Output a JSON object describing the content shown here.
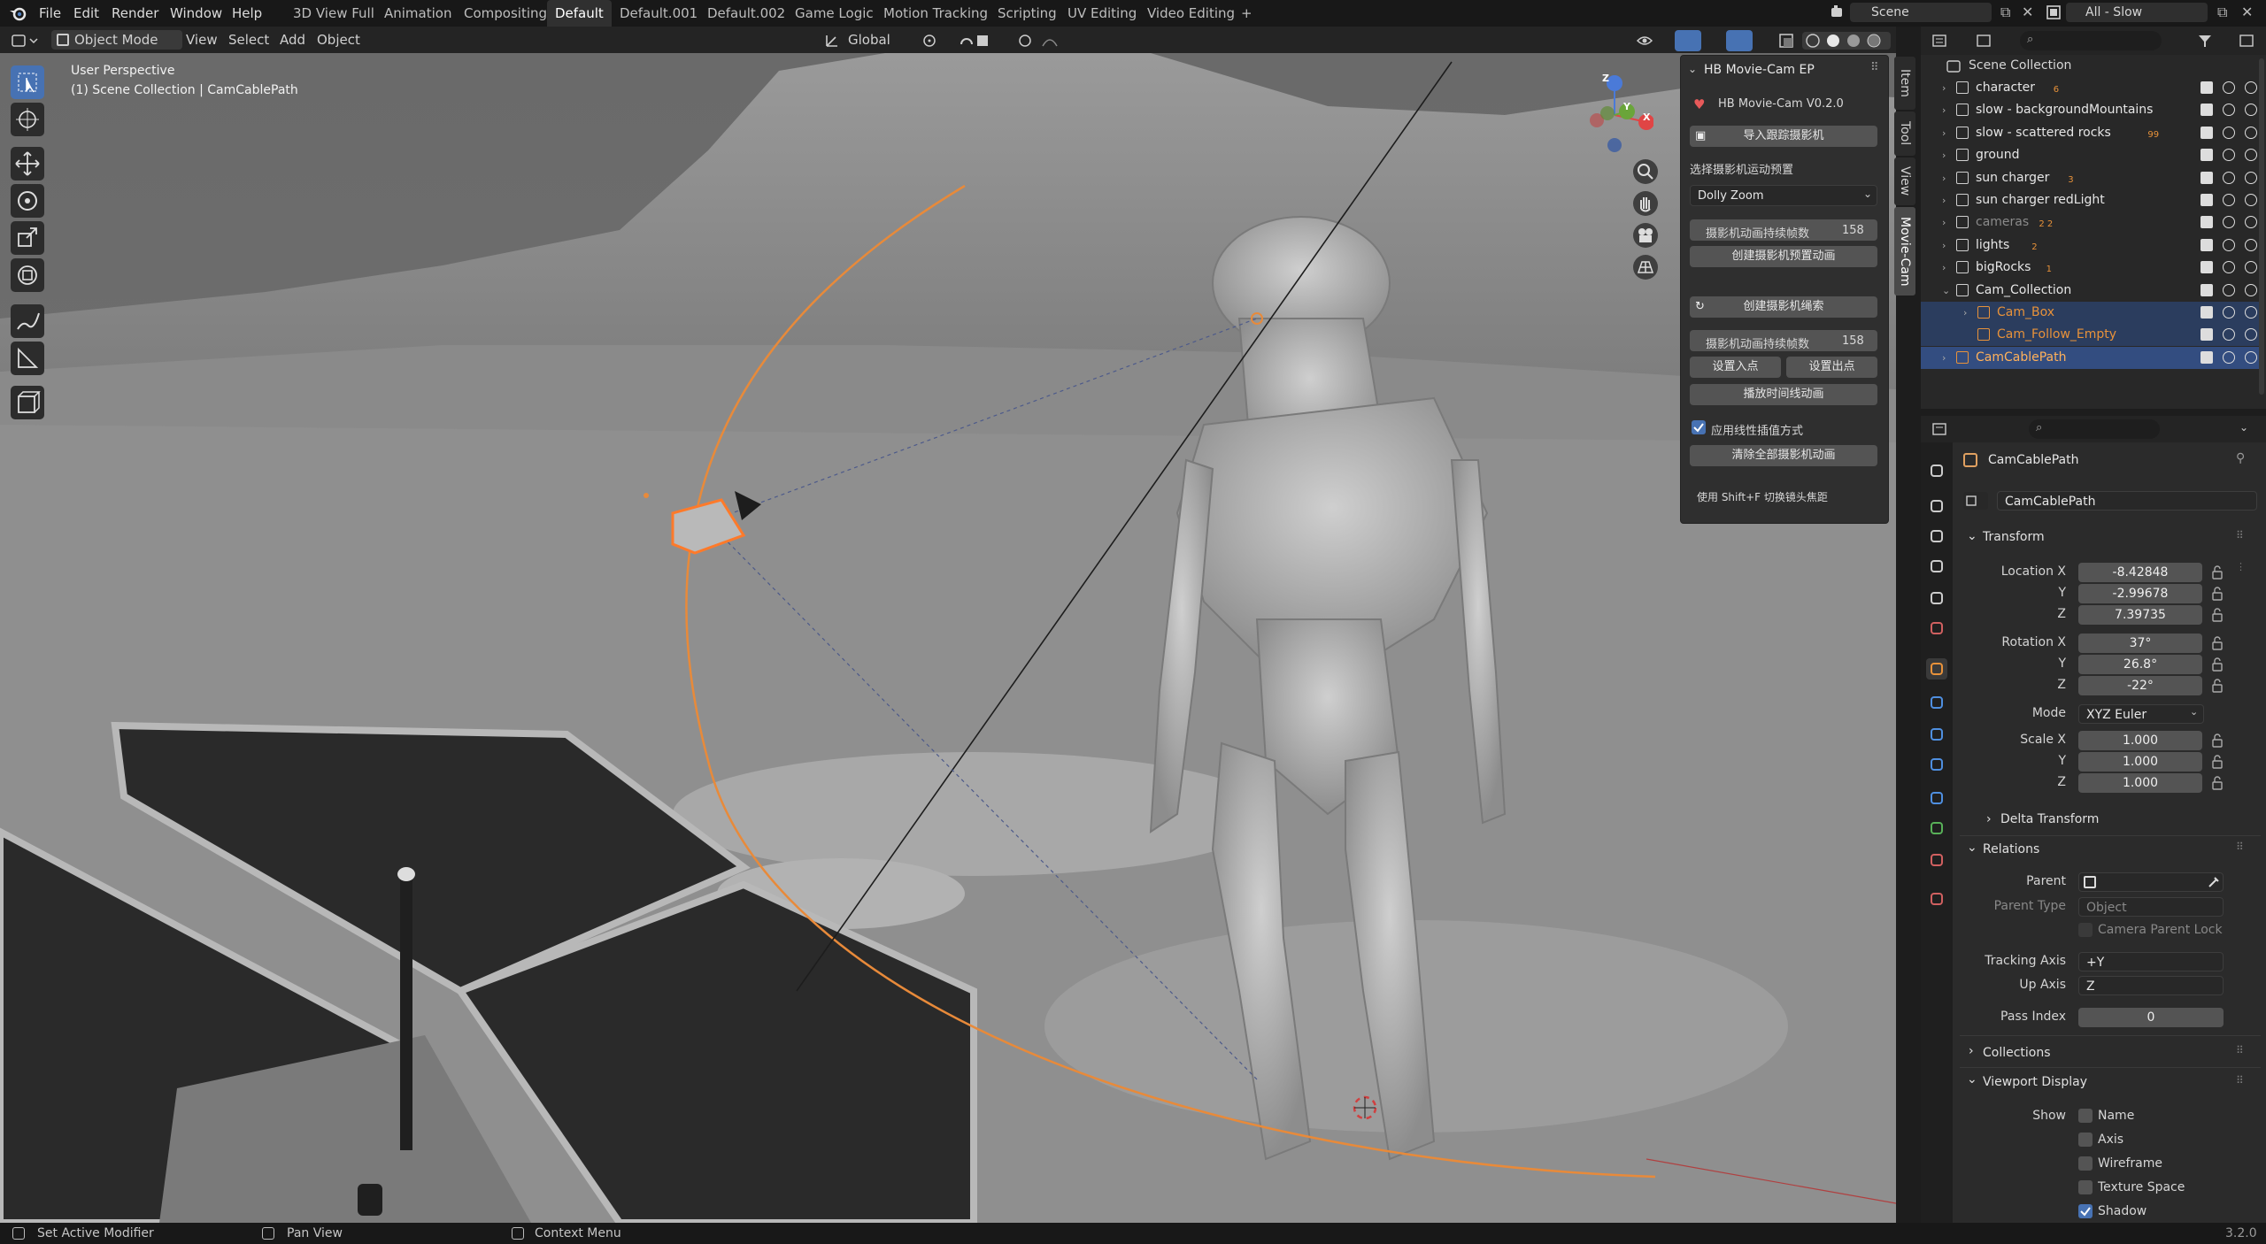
{
  "menu": {
    "file": "File",
    "edit": "Edit",
    "render": "Render",
    "window": "Window",
    "help": "Help"
  },
  "workspaces": [
    "3D View Full",
    "Animation",
    "Compositing",
    "Default",
    "Default.001",
    "Default.002",
    "Game Logic",
    "Motion Tracking",
    "Scripting",
    "UV Editing",
    "Video Editing"
  ],
  "workspace_add": "+",
  "scene": {
    "name": "Scene",
    "view_layer": "All - Slow"
  },
  "viewport_header": {
    "mode": "Object Mode",
    "view": "View",
    "select": "Select",
    "add": "Add",
    "object": "Object",
    "orientation": "Global"
  },
  "overlay_text": {
    "perspective": "User Perspective",
    "collection": "(1) Scene Collection | CamCablePath"
  },
  "gizmo": {
    "x": "X",
    "y": "Y",
    "z": "Z"
  },
  "side_tabs": [
    "Item",
    "Tool",
    "View",
    "Movie-Cam"
  ],
  "npanel": {
    "title": "HB Movie-Cam EP",
    "version": "HB Movie-Cam  V0.2.0",
    "import_btn": "导入跟踪摄影机",
    "preset_label": "选择摄影机运动预置",
    "preset_value": "Dolly Zoom",
    "duration1_label": "摄影机动画持续帧数",
    "duration1_value": "158",
    "create_preset_btn": "创建摄影机预置动画",
    "create_rope_btn": "创建摄影机绳索",
    "duration2_label": "摄影机动画持续帧数",
    "duration2_value": "158",
    "set_in_btn": "设置入点",
    "set_out_btn": "设置出点",
    "play_btn": "播放时间线动画",
    "linear_label": "应用线性插值方式",
    "clear_btn": "清除全部摄影机动画",
    "hint": "使用 Shift+F 切换镜头焦距"
  },
  "outliner": {
    "root": "Scene Collection",
    "rows": [
      {
        "name": "character",
        "badge": "6"
      },
      {
        "name": "slow - backgroundMountains",
        "badge": ""
      },
      {
        "name": "slow - scattered rocks",
        "badge": "99"
      },
      {
        "name": "ground",
        "badge": ""
      },
      {
        "name": "sun charger",
        "badge": "3"
      },
      {
        "name": "sun charger redLight",
        "badge": ""
      },
      {
        "name": "cameras",
        "badge": "2  2"
      },
      {
        "name": "lights",
        "badge": "2"
      },
      {
        "name": "bigRocks",
        "badge": "1"
      },
      {
        "name": "Cam_Collection",
        "badge": ""
      },
      {
        "name": "Cam_Box",
        "badge": ""
      },
      {
        "name": "Cam_Follow_Empty",
        "badge": ""
      },
      {
        "name": "CamCablePath",
        "badge": ""
      }
    ]
  },
  "properties": {
    "object_name": "CamCablePath",
    "data_name": "CamCablePath",
    "transform_title": "Transform",
    "location_x_label": "Location X",
    "location_x": "-8.42848",
    "location_y_label": "Y",
    "location_y": "-2.99678",
    "location_z_label": "Z",
    "location_z": "7.39735",
    "rotation_x_label": "Rotation X",
    "rotation_x": "37°",
    "rotation_y_label": "Y",
    "rotation_y": "26.8°",
    "rotation_z_label": "Z",
    "rotation_z": "-22°",
    "mode_label": "Mode",
    "mode": "XYZ Euler",
    "scale_x_label": "Scale X",
    "scale_x": "1.000",
    "scale_y_label": "Y",
    "scale_y": "1.000",
    "scale_z_label": "Z",
    "scale_z": "1.000",
    "delta_title": "Delta Transform",
    "relations_title": "Relations",
    "parent_label": "Parent",
    "parent_type_label": "Parent Type",
    "parent_type": "Object",
    "camera_parent_lock": "Camera Parent Lock",
    "tracking_axis_label": "Tracking Axis",
    "tracking_axis": "+Y",
    "up_axis_label": "Up Axis",
    "up_axis": "Z",
    "pass_index_label": "Pass Index",
    "pass_index": "0",
    "collections_title": "Collections",
    "viewport_display_title": "Viewport Display",
    "show_label": "Show",
    "show_name": "Name",
    "show_axis": "Axis",
    "show_wireframe": "Wireframe",
    "show_texture_space": "Texture Space",
    "show_shadow": "Shadow"
  },
  "statusbar": {
    "left": "Set Active Modifier",
    "middle": "Pan View",
    "right": "Context Menu",
    "version": "3.2.0"
  }
}
